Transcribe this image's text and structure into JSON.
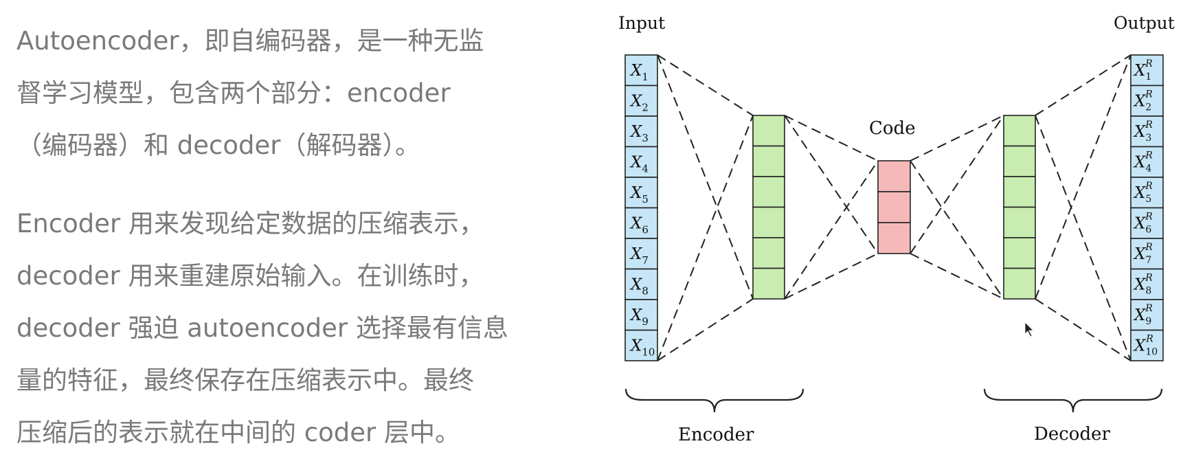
{
  "text": {
    "paragraph1": [
      "Autoencoder，即自编码器，是一种无监",
      "督学习模型，包含两个部分：encoder",
      "（编码器）和 decoder（解码器）。"
    ],
    "paragraph2": [
      "Encoder 用来发现给定数据的压缩表示，",
      "decoder 用来重建原始输入。在训练时，",
      "decoder 强迫 autoencoder 选择最有信息",
      "量的特征，最终保存在压缩表示中。最终",
      "压缩后的表示就在中间的 coder 层中。"
    ]
  },
  "diagram": {
    "input_title": "Input",
    "output_title": "Output",
    "code_label": "Code",
    "encoder_label": "Encoder",
    "decoder_label": "Decoder",
    "input_symbol": "X",
    "output_superscript": "R",
    "input_indices": [
      "1",
      "2",
      "3",
      "4",
      "5",
      "6",
      "7",
      "8",
      "9",
      "10"
    ],
    "output_indices": [
      "1",
      "2",
      "3",
      "4",
      "5",
      "6",
      "7",
      "8",
      "9",
      "10"
    ],
    "hidden_cell_count": 6,
    "code_cell_count": 3,
    "colors": {
      "input_fill": "#c6e6f7",
      "hidden_fill": "#c9ecb0",
      "code_fill": "#f6b9b9",
      "stroke": "#222222"
    }
  }
}
